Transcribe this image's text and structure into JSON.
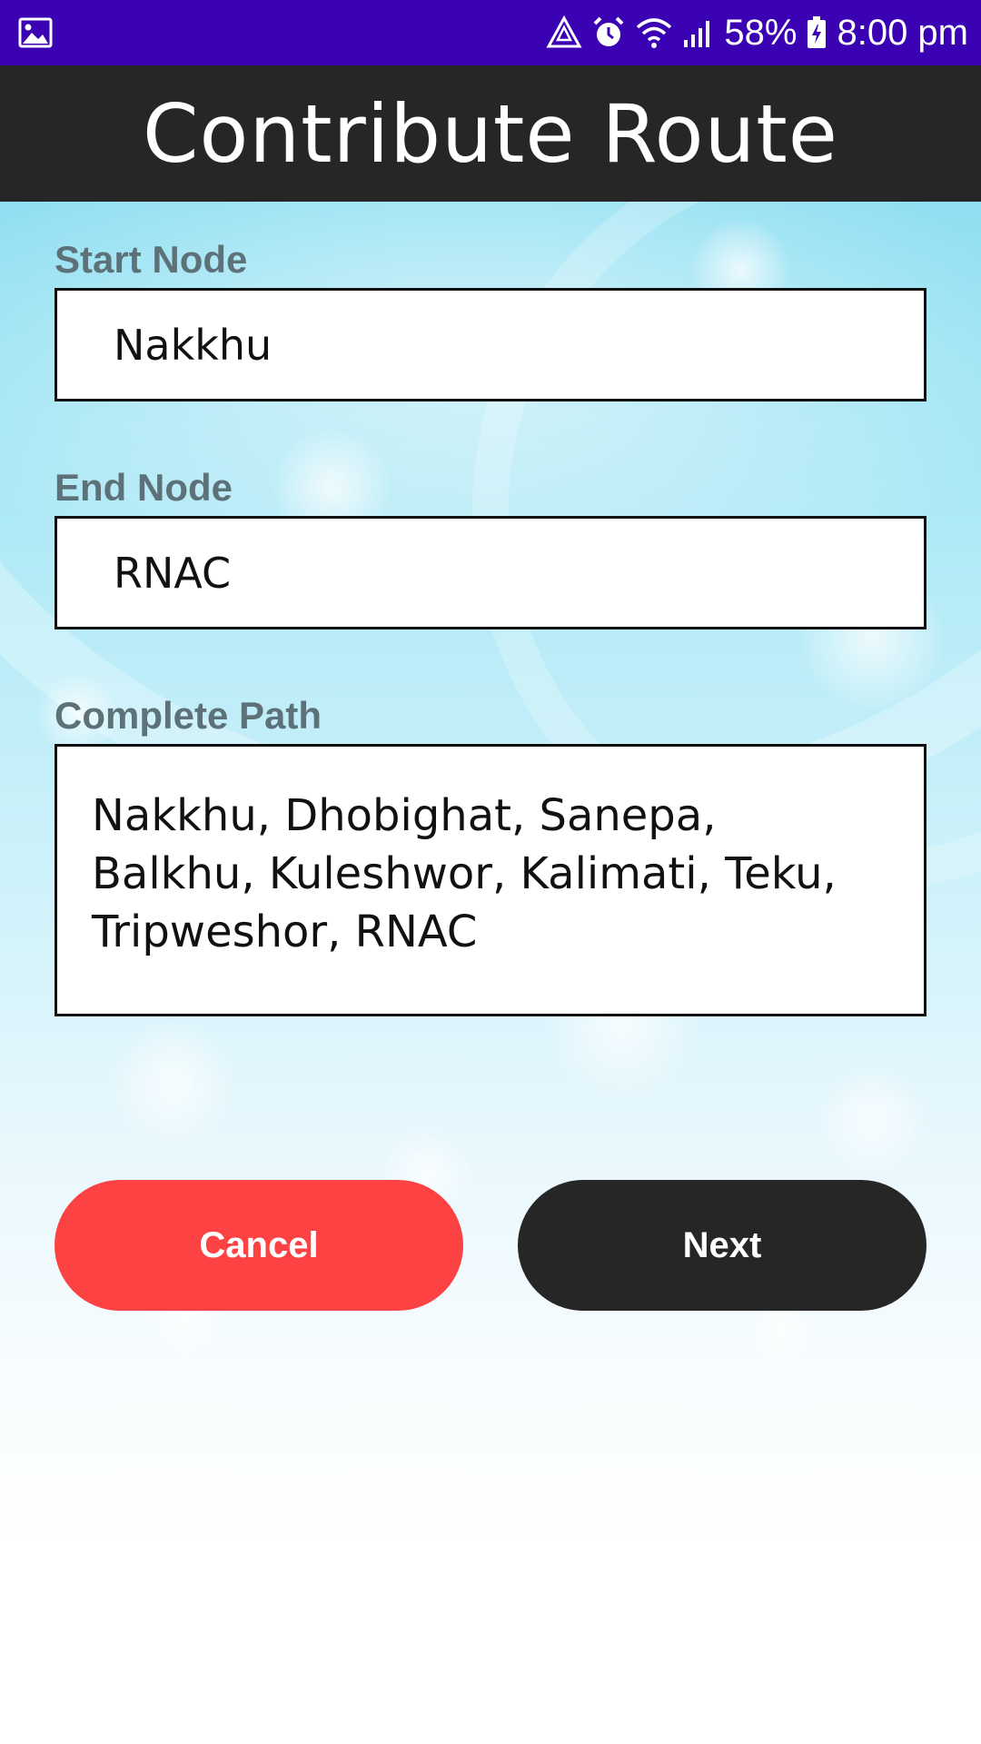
{
  "status_bar": {
    "icons": [
      "gallery-icon",
      "recycle-icon",
      "alarm-icon",
      "wifi-icon",
      "signal-icon",
      "battery-icon"
    ],
    "battery": "58%",
    "time": "8:00 pm"
  },
  "header": {
    "title": "Contribute Route"
  },
  "form": {
    "start_node_label": "Start Node",
    "start_node_value": "Nakkhu",
    "end_node_label": "End Node",
    "end_node_value": "RNAC",
    "complete_path_label": "Complete Path",
    "complete_path_value": "Nakkhu, Dhobighat, Sanepa, Balkhu, Kuleshwor, Kalimati, Teku, Tripweshor, RNAC"
  },
  "buttons": {
    "cancel_label": "Cancel",
    "next_label": "Next"
  },
  "colors": {
    "status_bar": "#3b02b3",
    "title_bar": "#262626",
    "cancel": "#fd4244",
    "next": "#262626",
    "label": "#5d7278"
  }
}
